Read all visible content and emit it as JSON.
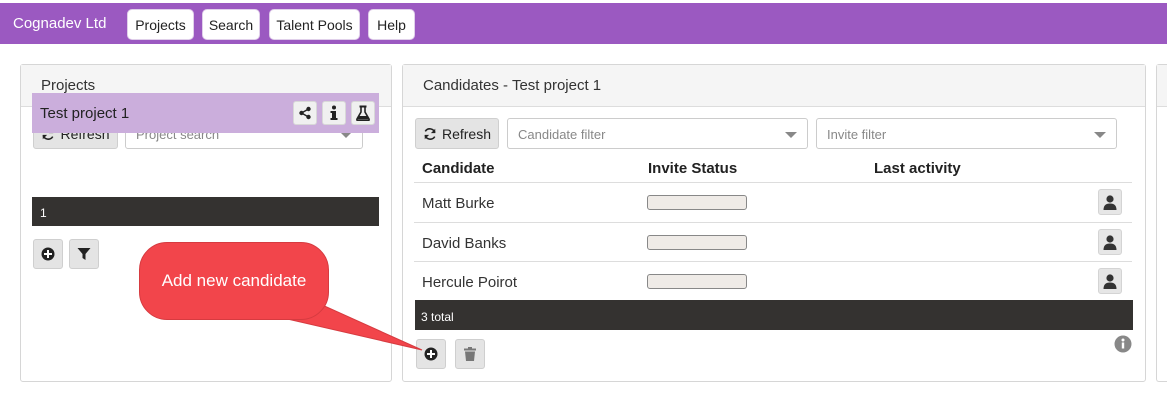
{
  "nav": {
    "brand": "Cognadev Ltd",
    "items": [
      "Projects",
      "Search",
      "Talent Pools",
      "Help"
    ]
  },
  "projects_panel": {
    "title": "Projects",
    "refresh_label": "Refresh",
    "search_placeholder": "Project search",
    "projects": [
      {
        "name": "Test project 1",
        "count": "1"
      }
    ]
  },
  "candidates_panel": {
    "title": "Candidates - Test project 1",
    "refresh_label": "Refresh",
    "candidate_filter_placeholder": "Candidate filter",
    "invite_filter_placeholder": "Invite filter",
    "columns": [
      "Candidate",
      "Invite Status",
      "Last activity"
    ],
    "rows": [
      {
        "name": "Matt Burke"
      },
      {
        "name": "David Banks"
      },
      {
        "name": "Hercule Poirot"
      }
    ],
    "total": "3 total"
  },
  "callout": {
    "text": "Add new candidate"
  },
  "colors": {
    "nav_bg": "#9b59c1",
    "selected_project_bg": "#cbaedc",
    "dark_bar": "#343230",
    "callout": "#f2454b"
  }
}
